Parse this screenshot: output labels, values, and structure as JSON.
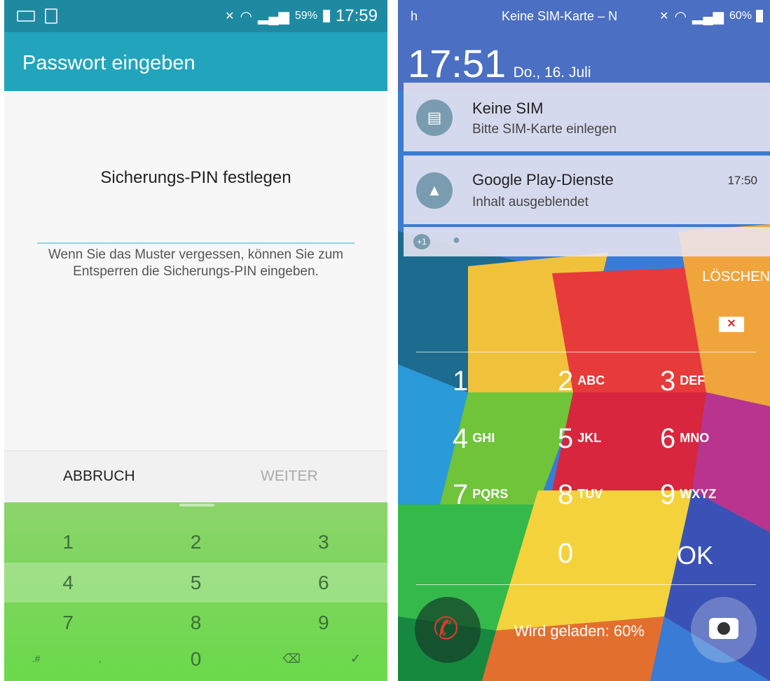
{
  "left": {
    "status": {
      "battery": "59%",
      "time": "17:59"
    },
    "app_bar_title": "Passwort eingeben",
    "pin_title": "Sicherungs-PIN festlegen",
    "pin_hint": "Wenn Sie das Muster vergessen, können Sie zum Entsperren die Sicherungs-PIN eingeben.",
    "buttons": {
      "cancel": "ABBRUCH",
      "next": "WEITER"
    },
    "keypad": {
      "row1": [
        "1",
        "2",
        "3"
      ],
      "row2": [
        "4",
        "5",
        "6"
      ],
      "row3": [
        "7",
        "8",
        "9"
      ],
      "row4": {
        "symbols": ".#",
        "comma": ",",
        "zero": "0"
      }
    },
    "colors": {
      "accent": "#23a4bd",
      "keyboard": "#7ad75a"
    }
  },
  "right": {
    "status": {
      "carrier": "Keine SIM-Karte – N",
      "left_text": "h",
      "battery": "60%"
    },
    "clock": {
      "time": "17:51",
      "date": "Do., 16. Juli"
    },
    "notifications": [
      {
        "title": "Keine SIM",
        "subtitle": "Bitte SIM-Karte einlegen",
        "time": "",
        "icon": "sim-icon"
      },
      {
        "title": "Google Play-Dienste",
        "subtitle": "Inhalt ausgeblendet",
        "time": "17:50",
        "icon": "warning-icon"
      }
    ],
    "notification_more": "+1",
    "clear_label": "LÖSCHEN",
    "keys": [
      {
        "n": "1",
        "l": ""
      },
      {
        "n": "2",
        "l": "ABC"
      },
      {
        "n": "3",
        "l": "DEF"
      },
      {
        "n": "4",
        "l": "GHI"
      },
      {
        "n": "5",
        "l": "JKL"
      },
      {
        "n": "6",
        "l": "MNO"
      },
      {
        "n": "7",
        "l": "PQRS"
      },
      {
        "n": "8",
        "l": "TUV"
      },
      {
        "n": "9",
        "l": "WXYZ"
      },
      {
        "n": "0",
        "l": ""
      }
    ],
    "ok_label": "OK",
    "charging": "Wird geladen: 60%"
  }
}
